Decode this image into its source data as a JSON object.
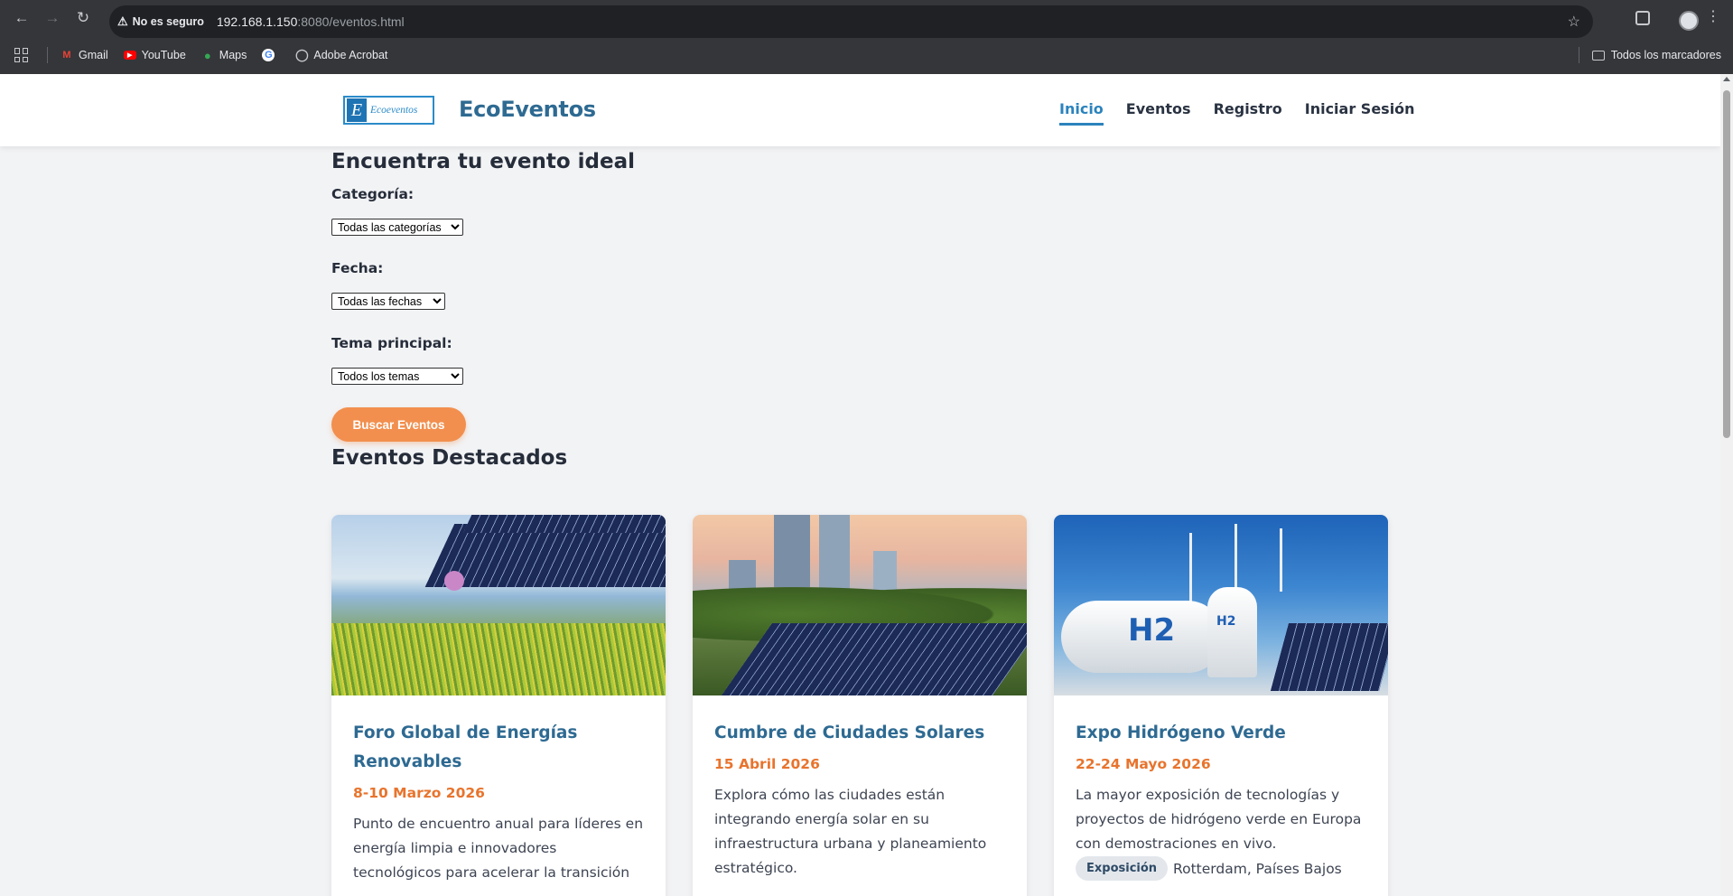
{
  "browser": {
    "security_label": "No es seguro",
    "url_host": "192.168.1.150",
    "url_path": ":8080/eventos.html",
    "bookmarks": [
      {
        "label": "Gmail",
        "icon": "gmail-icon",
        "color": "#ea4335"
      },
      {
        "label": "YouTube",
        "icon": "youtube-icon",
        "color": "#ff0000"
      },
      {
        "label": "Maps",
        "icon": "maps-icon",
        "color": "#34a853"
      },
      {
        "label": "",
        "icon": "google-icon",
        "color": "#4285f4"
      },
      {
        "label": "Adobe Acrobat",
        "icon": "globe-icon",
        "color": "#c8c9cc"
      }
    ],
    "all_bookmarks_label": "Todos los marcadores"
  },
  "site": {
    "logo_text": "Ecoeventos",
    "brand": "EcoEventos",
    "nav": [
      {
        "label": "Inicio",
        "active": true
      },
      {
        "label": "Eventos",
        "active": false
      },
      {
        "label": "Registro",
        "active": false
      },
      {
        "label": "Iniciar Sesión",
        "active": false
      }
    ]
  },
  "search": {
    "title": "Encuentra tu evento ideal",
    "category_label": "Categoría:",
    "category_value": "Todas las categorías",
    "date_label": "Fecha:",
    "date_value": "Todas las fechas",
    "topic_label": "Tema principal:",
    "topic_value": "Todos los temas",
    "button_label": "Buscar Eventos"
  },
  "featured": {
    "title": "Eventos Destacados",
    "cards": [
      {
        "title": "Foro Global de Energías Renovables",
        "date": "8-10 Marzo 2026",
        "description": "Punto de encuentro anual para líderes en energía limpia e innovadores tecnológicos para acelerar la transición"
      },
      {
        "title": "Cumbre de Ciudades Solares",
        "date": "15 Abril 2026",
        "description": "Explora cómo las ciudades están integrando energía solar en su infraestructura urbana y planeamiento estratégico."
      },
      {
        "title": "Expo Hidrógeno Verde",
        "date": "22-24 Mayo 2026",
        "description": "La mayor exposición de tecnologías y proyectos de hidrógeno verde en Europa con demostraciones en vivo.",
        "tag": "Exposición",
        "location": "Rotterdam, Países Bajos"
      }
    ]
  },
  "colors": {
    "brand": "#2e6a92",
    "accent": "#f28f4e",
    "date": "#e8742d",
    "nav_active": "#2b83bd"
  }
}
